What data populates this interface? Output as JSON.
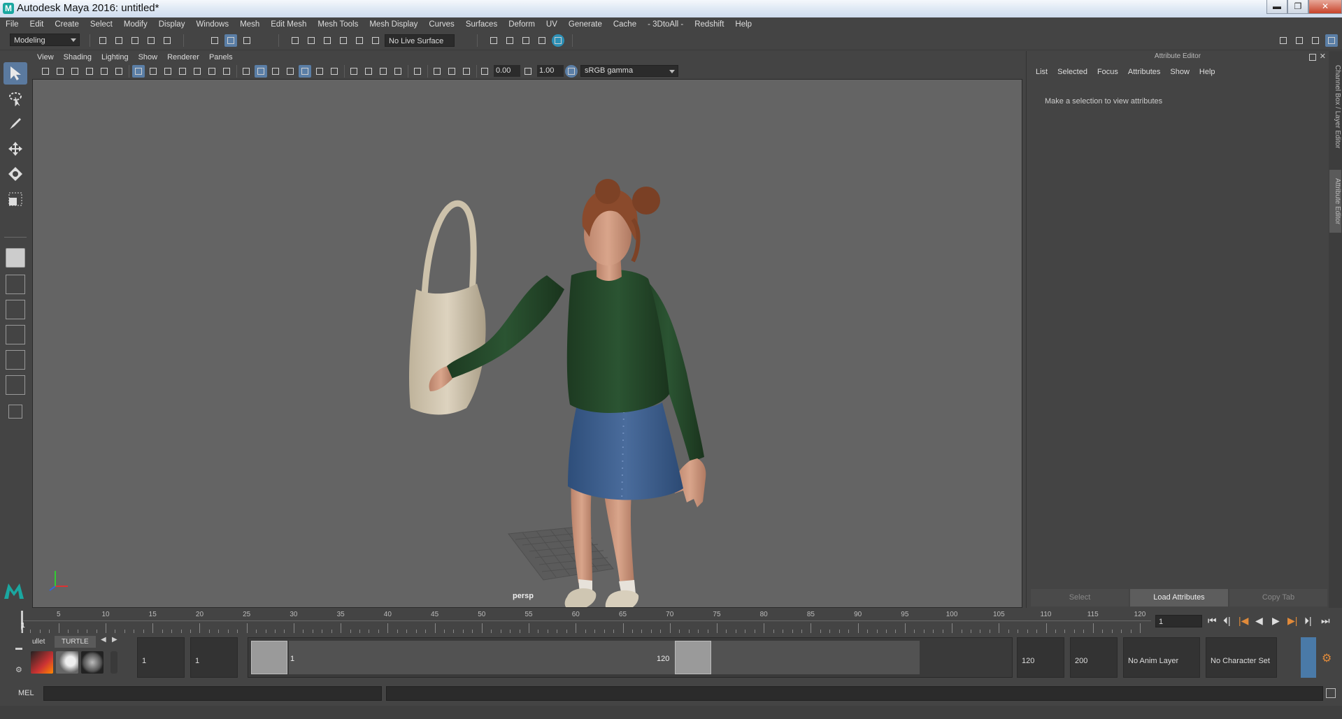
{
  "window": {
    "title": "Autodesk Maya 2016: untitled*",
    "logo": "M",
    "min_label": "▬",
    "max_label": "❐",
    "close_label": "✕"
  },
  "menubar": [
    "File",
    "Edit",
    "Create",
    "Select",
    "Modify",
    "Display",
    "Windows",
    "Mesh",
    "Edit Mesh",
    "Mesh Tools",
    "Mesh Display",
    "Curves",
    "Surfaces",
    "Deform",
    "UV",
    "Generate",
    "Cache",
    "- 3DtoAll -",
    "Redshift",
    "Help"
  ],
  "statusline": {
    "mode": "Modeling",
    "live_surface": "No Live Surface"
  },
  "viewport": {
    "menu": [
      "View",
      "Shading",
      "Lighting",
      "Show",
      "Renderer",
      "Panels"
    ],
    "exposure": "0.00",
    "gamma": "1.00",
    "color_space": "sRGB gamma",
    "camera": "persp"
  },
  "attribute_editor": {
    "header": "Attribute Editor",
    "menu": [
      "List",
      "Selected",
      "Focus",
      "Attributes",
      "Show",
      "Help"
    ],
    "message": "Make a selection to view attributes",
    "buttons": {
      "select": "Select",
      "load": "Load Attributes",
      "copy": "Copy Tab"
    }
  },
  "side_tabs": {
    "channel_box": "Channel Box / Layer Editor",
    "attribute_editor": "Attribute Editor"
  },
  "timeline": {
    "first_label": "1",
    "ticks": [
      "5",
      "10",
      "15",
      "20",
      "25",
      "30",
      "35",
      "40",
      "45",
      "50",
      "55",
      "60",
      "65",
      "70",
      "75",
      "80",
      "85",
      "90",
      "95",
      "100",
      "105",
      "110",
      "115",
      "120"
    ],
    "current_frame": "1"
  },
  "playback": [
    "⏮",
    "⏴|",
    "|◀",
    "◀",
    "▶",
    "▶|",
    "⏵|",
    "⏭"
  ],
  "range": {
    "start": "1",
    "playback_start": "1",
    "inner_start": "1",
    "inner_end": "120",
    "playback_end": "120",
    "end": "200",
    "anim_layer": "No Anim Layer",
    "character_set": "No Character Set"
  },
  "shelf": {
    "tab1": "ullet",
    "tab2": "TURTLE"
  },
  "command_line": {
    "label": "MEL"
  },
  "colors": {
    "accent": "#5b7a9f",
    "viewport_bg": "#646464",
    "panel_bg": "#444444",
    "maya_teal": "#1aa7a0"
  }
}
